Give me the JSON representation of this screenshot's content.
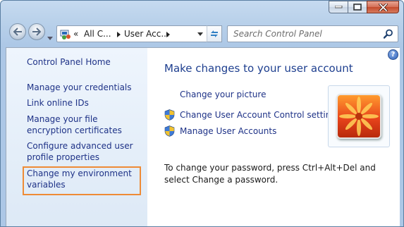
{
  "window": {
    "controls": [
      "minimize-icon",
      "maximize-icon",
      "close-icon"
    ]
  },
  "navigation": {
    "back_icon": "back-arrow-icon",
    "forward_icon": "forward-arrow-icon",
    "recent_icon": "chevron-down-icon",
    "breadcrumb": {
      "overflow": "«",
      "items": [
        "All C...",
        "User Acc..."
      ]
    },
    "refresh_icon": "refresh-icon",
    "search": {
      "placeholder": "Search Control Panel"
    }
  },
  "sidebar": {
    "home": "Control Panel Home",
    "links": [
      "Manage your credentials",
      "Link online IDs",
      "Manage your file encryption certificates",
      "Configure advanced user profile properties",
      "Change my environment variables"
    ]
  },
  "main": {
    "heading": "Make changes to your user account",
    "tasks": [
      {
        "label": "Change your picture",
        "icon": null
      },
      {
        "label": "Change User Account Control settings",
        "icon": "uac-shield-icon"
      },
      {
        "label": "Manage User Accounts",
        "icon": "uac-shield-icon"
      }
    ],
    "note": "To change your password, press Ctrl+Alt+Del and select Change a password."
  },
  "colors": {
    "link": "#1e3287",
    "heading": "#1e3f8f",
    "highlight": "#ee8b36"
  }
}
